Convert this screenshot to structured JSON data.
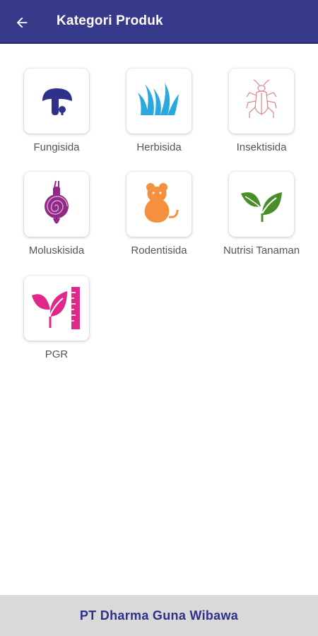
{
  "appbar": {
    "title": "Kategori Produk",
    "back_icon": "arrow-left-icon",
    "background": "#373a8a"
  },
  "categories": [
    {
      "label": "Fungisida",
      "icon": "mushroom-icon",
      "color": "#2e318a"
    },
    {
      "label": "Herbisida",
      "icon": "grass-icon",
      "color": "#29a9e0"
    },
    {
      "label": "Insektisida",
      "icon": "insect-icon",
      "color": "#d9868a"
    },
    {
      "label": "Moluskisida",
      "icon": "snail-icon",
      "color": "#8e2a86"
    },
    {
      "label": "Rodentisida",
      "icon": "mouse-icon",
      "color": "#f5913e"
    },
    {
      "label": "Nutrisi Tanaman",
      "icon": "leaves-icon",
      "color": "#4a8e2c"
    },
    {
      "label": "PGR",
      "icon": "leaf-ruler-icon",
      "color": "#e0288a"
    }
  ],
  "footer": {
    "company": "PT Dharma Guna Wibawa"
  }
}
